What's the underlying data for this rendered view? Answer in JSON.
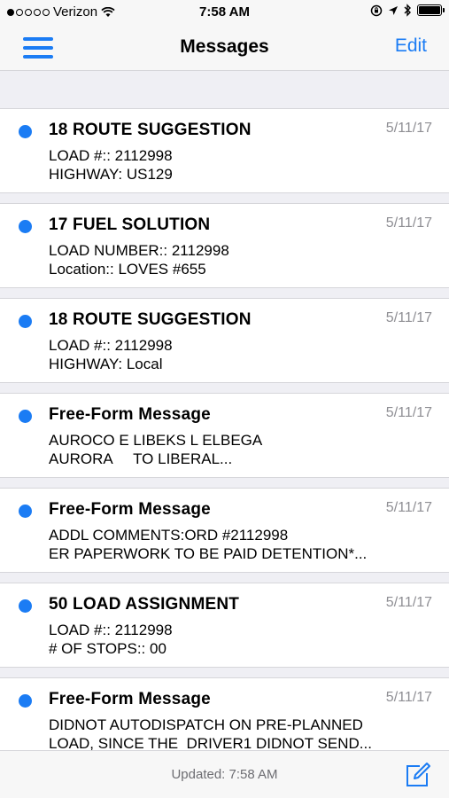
{
  "status_bar": {
    "carrier": "Verizon",
    "time": "7:58 AM"
  },
  "nav": {
    "title": "Messages",
    "edit_label": "Edit",
    "menu_icon": "hamburger-icon"
  },
  "messages": [
    {
      "title": "18 ROUTE SUGGESTION",
      "date": "5/11/17",
      "line1": "LOAD #:: 2112998",
      "line2": "HIGHWAY: US129",
      "unread": true
    },
    {
      "title": "17 FUEL SOLUTION",
      "date": "5/11/17",
      "line1": "LOAD NUMBER:: 2112998",
      "line2": "Location:: LOVES #655",
      "unread": true
    },
    {
      "title": "18 ROUTE SUGGESTION",
      "date": "5/11/17",
      "line1": "LOAD #:: 2112998",
      "line2": "HIGHWAY: Local",
      "unread": true
    },
    {
      "title": "Free-Form Message",
      "date": "5/11/17",
      "line1": "AUROCO E LIBEKS L ELBEGA",
      "line2": "AURORA     TO LIBERAL...",
      "unread": true
    },
    {
      "title": "Free-Form Message",
      "date": "5/11/17",
      "line1": "ADDL COMMENTS:ORD #2112998",
      "line2": "ER PAPERWORK TO BE PAID DETENTION*...",
      "unread": true
    },
    {
      "title": "50 LOAD ASSIGNMENT",
      "date": "5/11/17",
      "line1": "LOAD #:: 2112998",
      "line2": "# OF STOPS:: 00",
      "unread": true
    },
    {
      "title": "Free-Form Message",
      "date": "5/11/17",
      "line1": "DIDNOT AUTODISPATCH ON PRE-PLANNED",
      "line2": "LOAD, SINCE THE  DRIVER1 DIDNOT SEND...",
      "unread": true
    }
  ],
  "toolbar": {
    "updated_text": "Updated: 7:58 AM",
    "compose_icon": "compose-icon"
  },
  "colors": {
    "accent": "#1b7cf4",
    "background": "#efeff4",
    "date_gray": "#8e8e93"
  }
}
